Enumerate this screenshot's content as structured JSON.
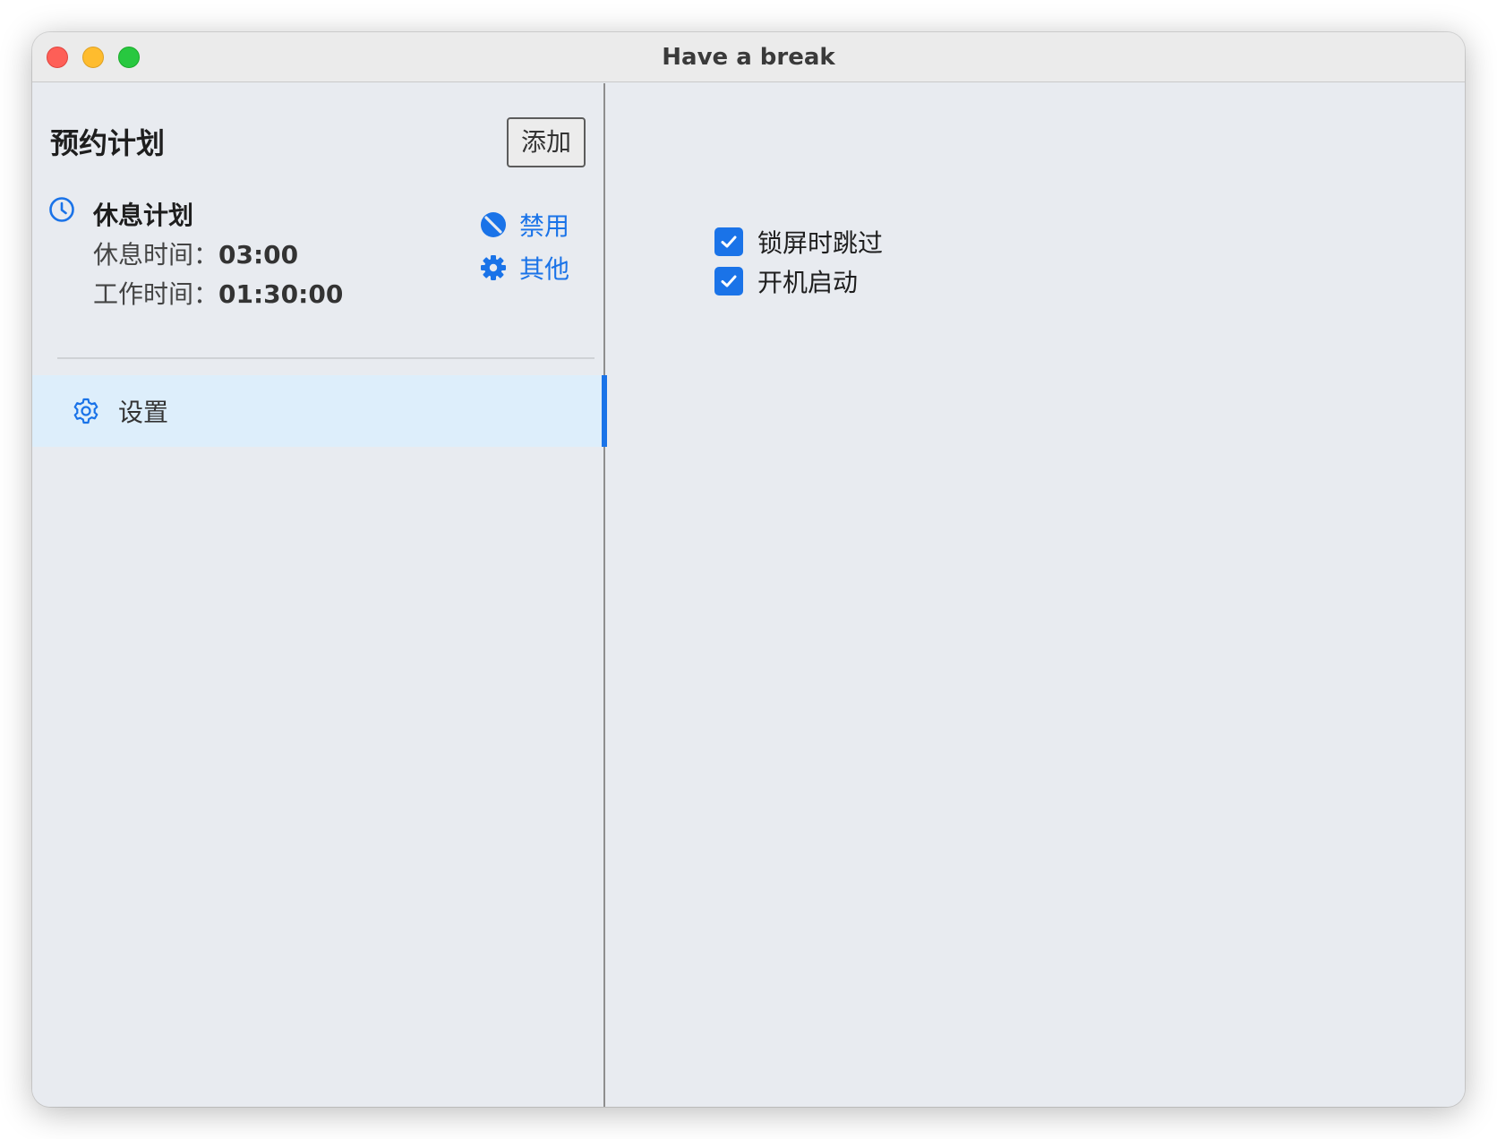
{
  "window": {
    "title": "Have a break"
  },
  "sidebar": {
    "heading": "预约计划",
    "add_label": "添加",
    "plan": {
      "name": "休息计划",
      "rest_label": "休息时间：",
      "rest_value": "03:00",
      "work_label": "工作时间：",
      "work_value": "01:30:00",
      "disable_label": "禁用",
      "other_label": "其他"
    },
    "nav": {
      "settings_label": "设置"
    }
  },
  "settings": {
    "options": [
      {
        "label": "锁屏时跳过",
        "checked": true
      },
      {
        "label": "开机启动",
        "checked": true
      }
    ]
  },
  "colors": {
    "accent": "#1a73e8",
    "selected_bg": "#ddeefb",
    "window_bg": "#e8ebf0"
  }
}
